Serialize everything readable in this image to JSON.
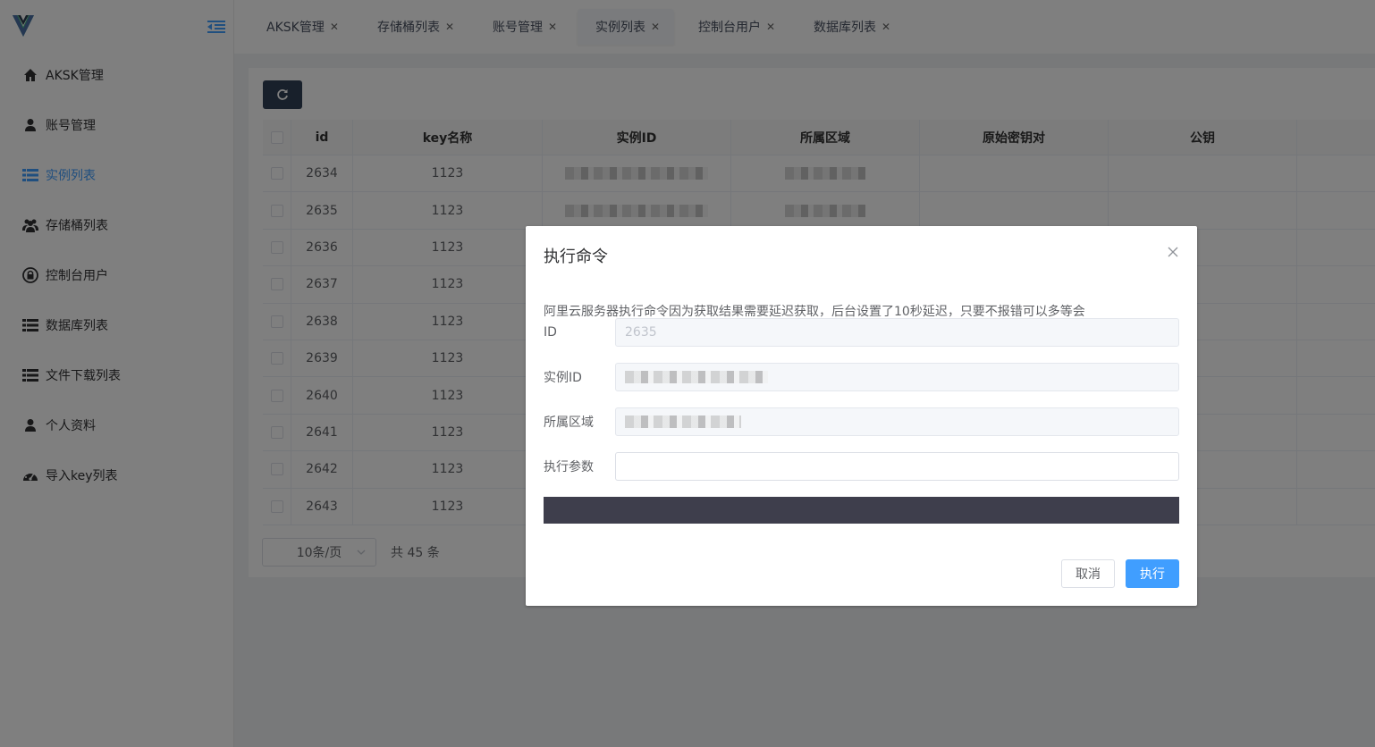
{
  "sidebar": {
    "items": [
      {
        "label": "AKSK管理",
        "icon": "home-icon"
      },
      {
        "label": "账号管理",
        "icon": "user-icon"
      },
      {
        "label": "实例列表",
        "icon": "list-icon",
        "active": true
      },
      {
        "label": "存储桶列表",
        "icon": "users-icon"
      },
      {
        "label": "控制台用户",
        "icon": "lock-icon"
      },
      {
        "label": "数据库列表",
        "icon": "list-icon"
      },
      {
        "label": "文件下载列表",
        "icon": "list-icon"
      },
      {
        "label": "个人资料",
        "icon": "user-icon"
      },
      {
        "label": "导入key列表",
        "icon": "dashboard-icon"
      }
    ]
  },
  "tabs": [
    {
      "label": "AKSK管理"
    },
    {
      "label": "存储桶列表"
    },
    {
      "label": "账号管理"
    },
    {
      "label": "实例列表",
      "active": true
    },
    {
      "label": "控制台用户"
    },
    {
      "label": "数据库列表"
    }
  ],
  "table": {
    "headers": {
      "id": "id",
      "key": "key名称",
      "instance": "实例ID",
      "region": "所属区域",
      "orig_keypair": "原始密钥对",
      "pubkey": "公钥"
    },
    "rows": [
      {
        "id": "2634",
        "key": "1123"
      },
      {
        "id": "2635",
        "key": "1123"
      },
      {
        "id": "2636",
        "key": "1123"
      },
      {
        "id": "2637",
        "key": "1123"
      },
      {
        "id": "2638",
        "key": "1123"
      },
      {
        "id": "2639",
        "key": "1123"
      },
      {
        "id": "2640",
        "key": "1123"
      },
      {
        "id": "2641",
        "key": "1123"
      },
      {
        "id": "2642",
        "key": "1123"
      },
      {
        "id": "2643",
        "key": "1123"
      }
    ]
  },
  "pager": {
    "page_size": "10条/页",
    "total": "共 45 条"
  },
  "dialog": {
    "title": "执行命令",
    "note": "阿里云服务器执行命令因为获取结果需要延迟获取，后台设置了10秒延迟，只要不报错可以多等会",
    "fields": {
      "id_label": "ID",
      "id_value": "2635",
      "instance_label": "实例ID",
      "region_label": "所属区域",
      "param_label": "执行参数",
      "param_value": ""
    },
    "cancel_label": "取消",
    "exec_label": "执行"
  },
  "colors": {
    "accent": "#409eff",
    "dark": "#304156",
    "output": "#3e3e4c"
  }
}
